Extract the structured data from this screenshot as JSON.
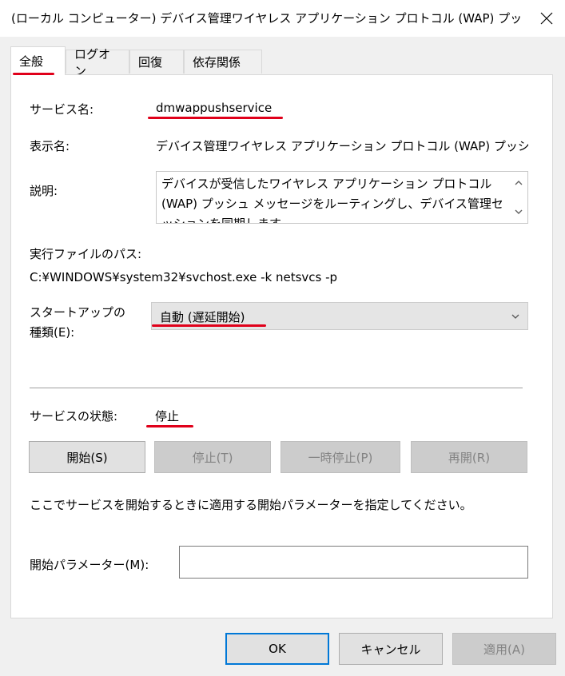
{
  "window": {
    "title": "(ローカル コンピューター) デバイス管理ワイヤレス アプリケーション プロトコル (WAP) プッシュ ...",
    "close_icon": "close-icon"
  },
  "tabs": [
    "全般",
    "ログオン",
    "回復",
    "依存関係"
  ],
  "general": {
    "service_name_label": "サービス名:",
    "service_name_value": "dmwappushservice",
    "display_name_label": "表示名:",
    "display_name_value": "デバイス管理ワイヤレス アプリケーション プロトコル (WAP) プッシュ メッセ",
    "description_label": "説明:",
    "description_value": "デバイスが受信したワイヤレス アプリケーション プロトコル (WAP) プッシュ メッセージをルーティングし、デバイス管理セッションを同期します",
    "exe_path_label": "実行ファイルのパス:",
    "exe_path_value": "C:¥WINDOWS¥system32¥svchost.exe -k netsvcs -p",
    "startup_type_label_1": "スタートアップの",
    "startup_type_label_2": "種類(E):",
    "startup_type_value": "自動 (遅延開始)",
    "status_label": "サービスの状態:",
    "status_value": "停止",
    "buttons": {
      "start": "開始(S)",
      "stop": "停止(T)",
      "pause": "一時停止(P)",
      "resume": "再開(R)"
    },
    "hint_text": "ここでサービスを開始するときに適用する開始パラメーターを指定してください。",
    "start_params_label": "開始パラメーター(M):",
    "start_params_value": ""
  },
  "footer": {
    "ok": "OK",
    "cancel": "キャンセル",
    "apply": "適用(A)"
  },
  "colors": {
    "annotation_red": "#e0001a",
    "focus_blue": "#0078d7"
  }
}
